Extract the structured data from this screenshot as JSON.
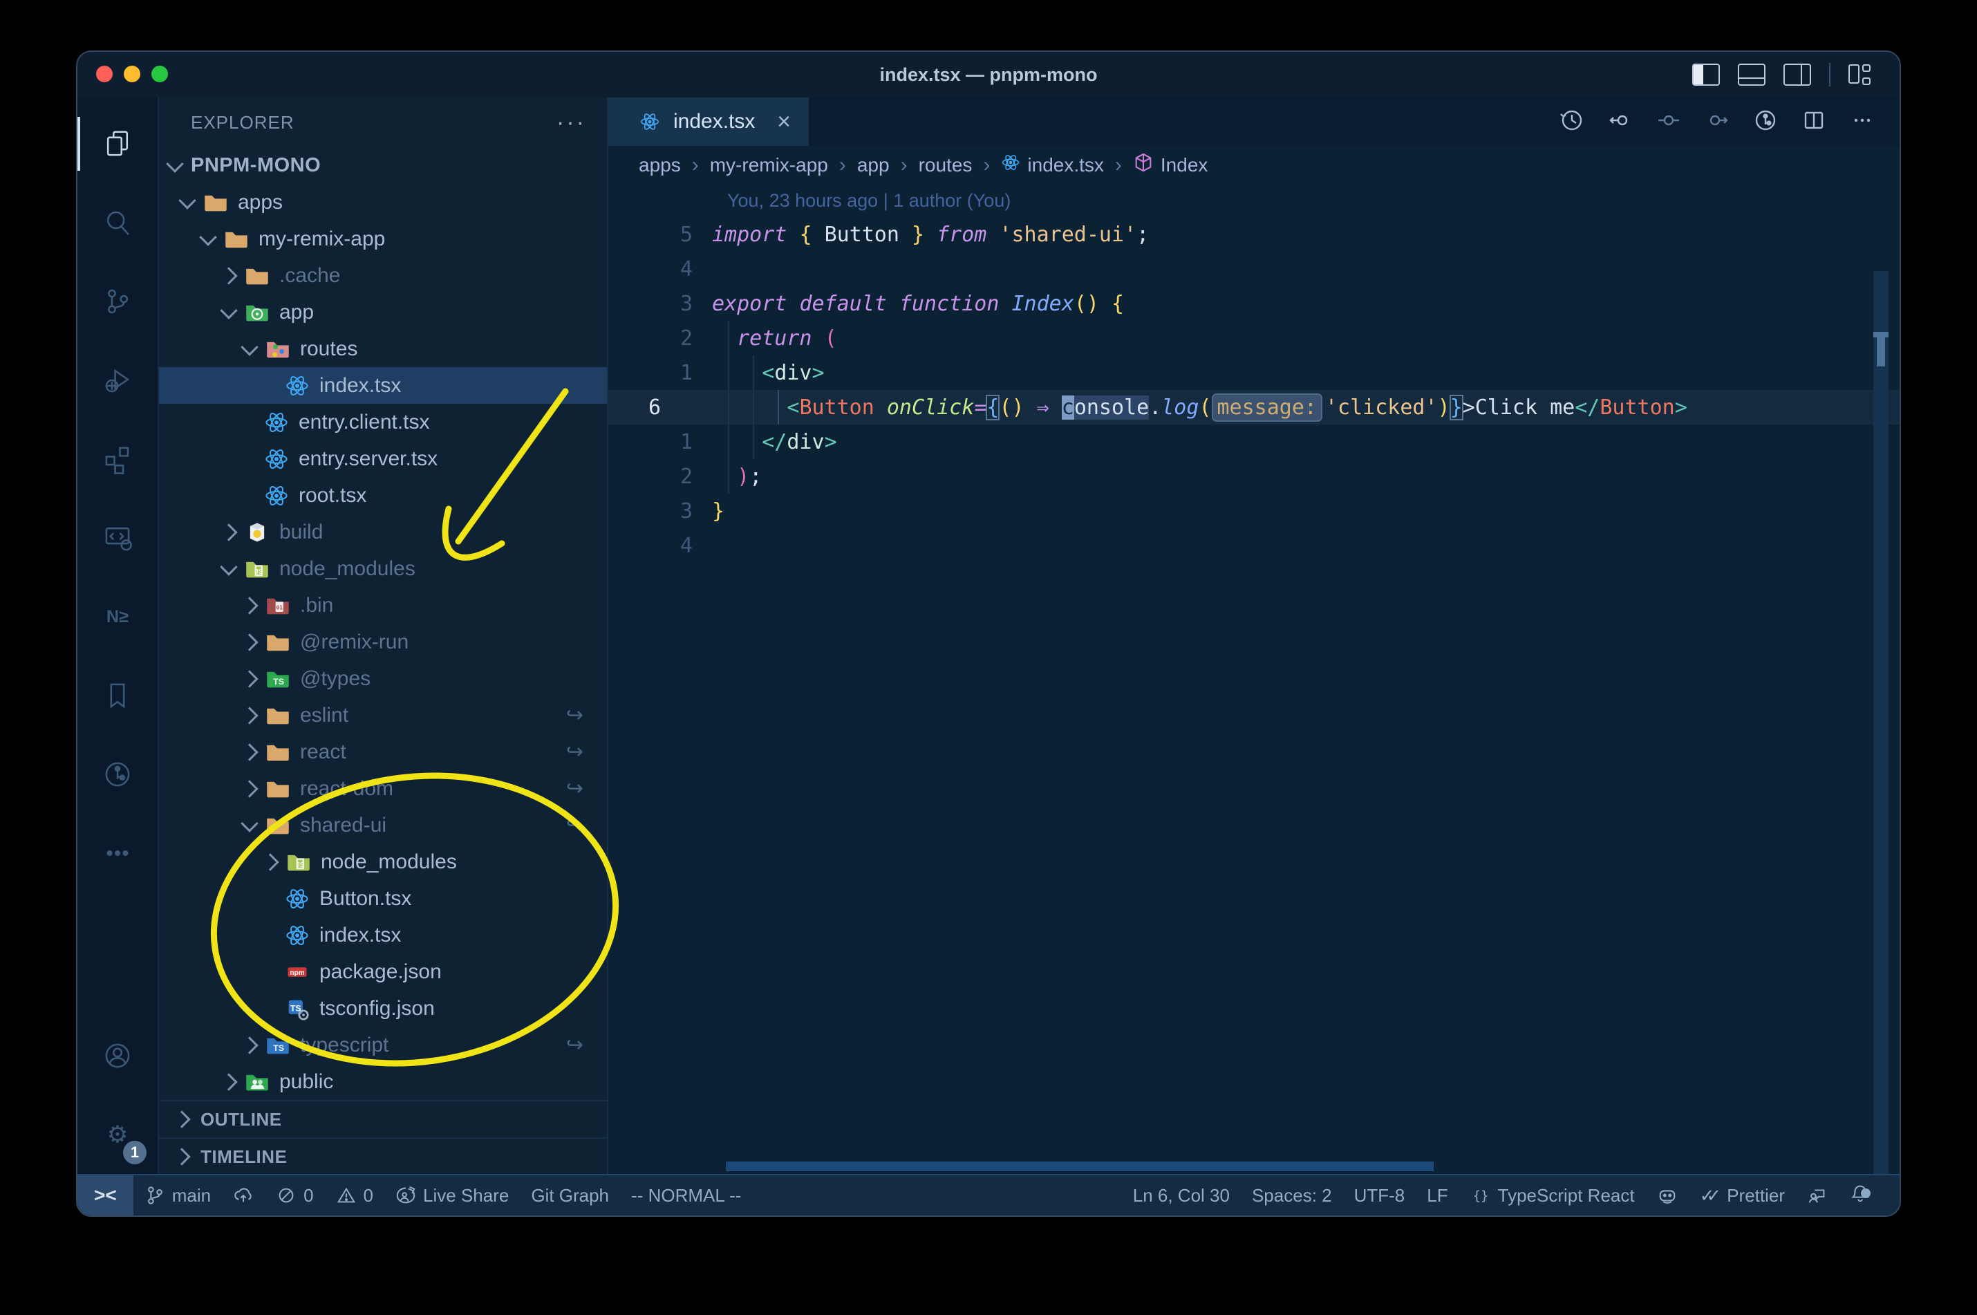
{
  "window": {
    "title": "index.tsx — pnpm-mono"
  },
  "titlebar": {
    "traffic_lights": [
      "#ff5f57",
      "#febc2e",
      "#28c840"
    ],
    "layout_icons": [
      "toggle-primary-sidebar",
      "toggle-panel",
      "toggle-secondary-sidebar",
      "customize-layout"
    ]
  },
  "activity_bar": {
    "items": [
      {
        "name": "explorer",
        "active": true
      },
      {
        "name": "search",
        "active": false
      },
      {
        "name": "source-control",
        "active": false
      },
      {
        "name": "run-and-debug",
        "active": false
      },
      {
        "name": "extensions",
        "active": false
      },
      {
        "name": "remote-explorer",
        "active": false
      },
      {
        "name": "nx-console",
        "active": false
      },
      {
        "name": "bookmarks",
        "active": false
      },
      {
        "name": "gitlens",
        "active": false
      },
      {
        "name": "more-views",
        "active": false
      }
    ],
    "bottom": [
      {
        "name": "accounts",
        "badge": ""
      },
      {
        "name": "settings",
        "badge": "1"
      }
    ]
  },
  "explorer": {
    "title": "EXPLORER",
    "more_actions": "···",
    "root": "PNPM-MONO",
    "tree": [
      {
        "label": "apps",
        "level": 1,
        "icon": "folder",
        "chevron": "open",
        "dim": false
      },
      {
        "label": "my-remix-app",
        "level": 2,
        "icon": "folder",
        "chevron": "open",
        "dim": false
      },
      {
        "label": ".cache",
        "level": 3,
        "icon": "folder",
        "chevron": "closed",
        "dim": true
      },
      {
        "label": "app",
        "level": 3,
        "icon": "folder-app",
        "chevron": "open",
        "dim": false
      },
      {
        "label": "routes",
        "level": 4,
        "icon": "folder-routes",
        "chevron": "open",
        "dim": false
      },
      {
        "label": "index.tsx",
        "level": 5,
        "icon": "react",
        "chevron": null,
        "dim": false,
        "selected": true
      },
      {
        "label": "entry.client.tsx",
        "level": 4,
        "icon": "react",
        "chevron": null,
        "dim": false
      },
      {
        "label": "entry.server.tsx",
        "level": 4,
        "icon": "react",
        "chevron": null,
        "dim": false
      },
      {
        "label": "root.tsx",
        "level": 4,
        "icon": "react",
        "chevron": null,
        "dim": false
      },
      {
        "label": "build",
        "level": 3,
        "icon": "folder-dist",
        "chevron": "closed",
        "dim": true
      },
      {
        "label": "node_modules",
        "level": 3,
        "icon": "folder-js",
        "chevron": "open",
        "dim": true
      },
      {
        "label": ".bin",
        "level": 4,
        "icon": "folder-bin",
        "chevron": "closed",
        "dim": true
      },
      {
        "label": "@remix-run",
        "level": 4,
        "icon": "folder",
        "chevron": "closed",
        "dim": true
      },
      {
        "label": "@types",
        "level": 4,
        "icon": "folder-types",
        "chevron": "closed",
        "dim": true
      },
      {
        "label": "eslint",
        "level": 4,
        "icon": "folder",
        "chevron": "closed",
        "dim": true,
        "symlink": true
      },
      {
        "label": "react",
        "level": 4,
        "icon": "folder",
        "chevron": "closed",
        "dim": true,
        "symlink": true
      },
      {
        "label": "react-dom",
        "level": 4,
        "icon": "folder",
        "chevron": "closed",
        "dim": true,
        "symlink": true
      },
      {
        "label": "shared-ui",
        "level": 4,
        "icon": "folder",
        "chevron": "open",
        "dim": true,
        "symlink": true
      },
      {
        "label": "node_modules",
        "level": 5,
        "icon": "folder-js",
        "chevron": "closed",
        "dim": false
      },
      {
        "label": "Button.tsx",
        "level": 5,
        "icon": "react",
        "chevron": null,
        "dim": false
      },
      {
        "label": "index.tsx",
        "level": 5,
        "icon": "react",
        "chevron": null,
        "dim": false
      },
      {
        "label": "package.json",
        "level": 5,
        "icon": "npm",
        "chevron": null,
        "dim": false
      },
      {
        "label": "tsconfig.json",
        "level": 5,
        "icon": "ts-config",
        "chevron": null,
        "dim": false
      },
      {
        "label": "typescript",
        "level": 4,
        "icon": "folder-ts",
        "chevron": "closed",
        "dim": true,
        "symlink": true
      },
      {
        "label": "public",
        "level": 3,
        "icon": "folder-public",
        "chevron": "closed",
        "dim": false
      }
    ],
    "sections": [
      {
        "label": "OUTLINE"
      },
      {
        "label": "TIMELINE"
      }
    ]
  },
  "editor": {
    "tab": {
      "label": "index.tsx",
      "close": "×"
    },
    "breadcrumbs": [
      {
        "label": "apps"
      },
      {
        "label": "my-remix-app"
      },
      {
        "label": "app"
      },
      {
        "label": "routes"
      },
      {
        "label": "index.tsx",
        "icon": "react"
      },
      {
        "label": "Index",
        "icon": "symbol-cube"
      }
    ],
    "blame": "You, 23 hours ago | 1 author (You)",
    "lines": [
      {
        "gutter": "5",
        "tokens": [
          [
            "kw",
            "import "
          ],
          [
            "b1",
            "{ "
          ],
          [
            "txt",
            "Button"
          ],
          [
            "b1",
            " }"
          ],
          [
            "kw",
            " from "
          ],
          [
            "str",
            "'shared-ui'"
          ],
          [
            "txt",
            ";"
          ]
        ]
      },
      {
        "gutter": "4",
        "tokens": []
      },
      {
        "gutter": "3",
        "tokens": [
          [
            "kw",
            "export "
          ],
          [
            "kw",
            "default "
          ],
          [
            "kw",
            "function "
          ],
          [
            "fn",
            "Index"
          ],
          [
            "b1",
            "()"
          ],
          [
            "txt",
            " "
          ],
          [
            "b1",
            "{"
          ]
        ]
      },
      {
        "gutter": "2",
        "tokens": [
          [
            "txt",
            "  "
          ],
          [
            "kw",
            "return "
          ],
          [
            "b2",
            "("
          ]
        ]
      },
      {
        "gutter": "1",
        "tokens": [
          [
            "txt",
            "    "
          ],
          [
            "tag",
            "<"
          ],
          [
            "tagn",
            "div"
          ],
          [
            "tag",
            ">"
          ]
        ]
      },
      {
        "gutter": "6",
        "current": true,
        "tokens": [
          [
            "txt",
            "      "
          ],
          [
            "tag",
            "<"
          ],
          [
            "cmp",
            "Button"
          ],
          [
            "txt",
            " "
          ],
          [
            "attr",
            "onClick"
          ],
          [
            "arr",
            "="
          ],
          [
            "b3 boxed",
            "{"
          ],
          [
            "b1",
            "()"
          ],
          [
            "txt",
            " "
          ],
          [
            "arr",
            "⇒"
          ],
          [
            "txt",
            " "
          ],
          [
            "cursor",
            "c"
          ],
          [
            "hl",
            "onsole"
          ],
          [
            "txt",
            "."
          ],
          [
            "fn",
            "log"
          ],
          [
            "b1",
            "("
          ],
          [
            "inlay",
            "message:"
          ],
          [
            "str",
            "'clicked'"
          ],
          [
            "b1",
            ")"
          ],
          [
            "b3 boxed",
            "}"
          ],
          [
            "txt",
            ">Click me"
          ],
          [
            "tag",
            "</"
          ],
          [
            "cmp",
            "Button"
          ],
          [
            "tag",
            ">"
          ]
        ]
      },
      {
        "gutter": "1",
        "tokens": [
          [
            "txt",
            "    "
          ],
          [
            "tag",
            "</"
          ],
          [
            "tagn",
            "div"
          ],
          [
            "tag",
            ">"
          ]
        ]
      },
      {
        "gutter": "2",
        "tokens": [
          [
            "txt",
            "  "
          ],
          [
            "b2",
            ")"
          ],
          [
            "txt",
            ";"
          ]
        ]
      },
      {
        "gutter": "3",
        "tokens": [
          [
            "b1",
            "}"
          ]
        ]
      },
      {
        "gutter": "4",
        "tokens": []
      }
    ]
  },
  "status_bar": {
    "left": [
      {
        "name": "remote-indicator",
        "label": "><"
      },
      {
        "name": "git-branch",
        "icon": "branch",
        "label": "main"
      },
      {
        "name": "sync-changes",
        "icon": "cloud-upload",
        "label": ""
      },
      {
        "name": "problems-errors",
        "icon": "error-circle",
        "label": "0"
      },
      {
        "name": "problems-warnings",
        "icon": "warning-triangle",
        "label": "0"
      },
      {
        "name": "live-share",
        "icon": "live-share",
        "label": "Live Share"
      },
      {
        "name": "git-graph",
        "icon": "",
        "label": "Git Graph"
      },
      {
        "name": "vim-mode",
        "icon": "",
        "label": "-- NORMAL --"
      }
    ],
    "right": [
      {
        "name": "cursor-position",
        "label": "Ln 6, Col 30"
      },
      {
        "name": "indentation",
        "label": "Spaces: 2"
      },
      {
        "name": "encoding",
        "label": "UTF-8"
      },
      {
        "name": "eol",
        "label": "LF"
      },
      {
        "name": "language-mode",
        "icon": "braces",
        "label": "TypeScript React"
      },
      {
        "name": "copilot",
        "icon": "copilot",
        "label": ""
      },
      {
        "name": "prettier",
        "icon": "double-check",
        "label": "Prettier"
      },
      {
        "name": "feedback",
        "icon": "feedback",
        "label": ""
      },
      {
        "name": "notifications",
        "icon": "bell-dot",
        "label": ""
      }
    ]
  },
  "annotations": {
    "color": "#f0e316",
    "shapes": [
      "arrow-to-node-modules",
      "ellipse-around-shared-ui"
    ]
  }
}
